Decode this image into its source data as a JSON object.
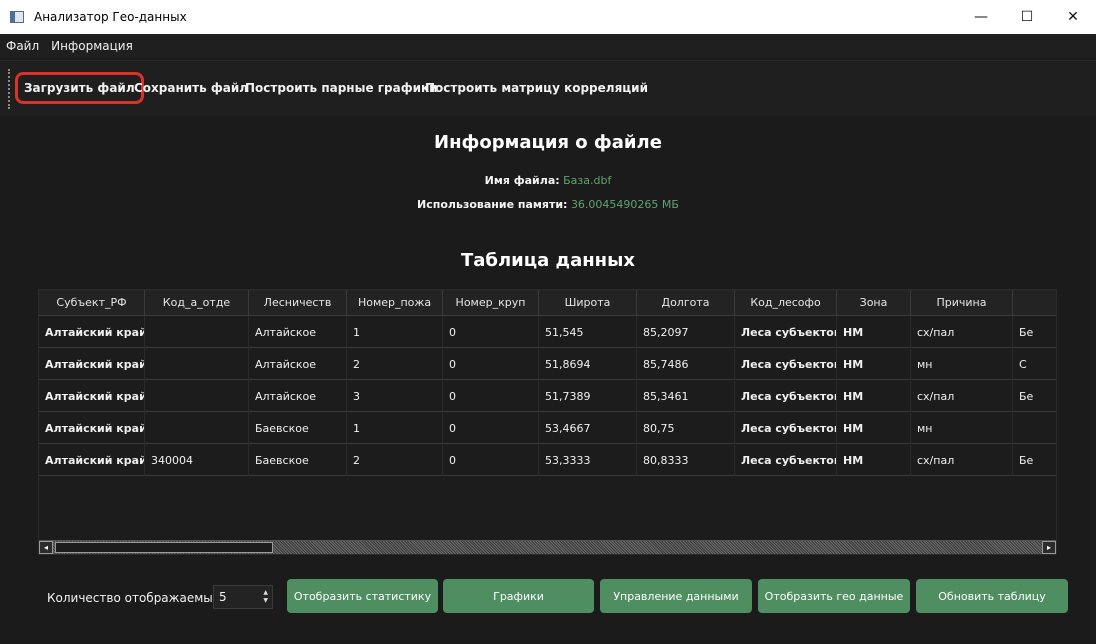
{
  "window": {
    "title": "Анализатор Гео-данных",
    "controls": {
      "minimize": "—",
      "maximize": "☐",
      "close": "✕"
    }
  },
  "menu": [
    "Файл",
    "Информация"
  ],
  "toolbar": {
    "load_file": "Загрузить файл",
    "save_file": "Сохранить файл",
    "pair_plots": "Построить парные графики",
    "corr_matrix": "Построить матрицу корреляций"
  },
  "file_info": {
    "heading": "Информация о файле",
    "name_label": "Имя файла:",
    "name_value": "База.dbf",
    "memory_label": "Использование памяти:",
    "memory_value": "36.0045490265 МБ"
  },
  "table": {
    "heading": "Таблица данных",
    "columns": [
      "Субъект_РФ",
      "Код_а_отде",
      "Лесничеств",
      "Номер_пожа",
      "Номер_круп",
      "Широта",
      "Долгота",
      "Код_лесофо",
      "Зона",
      "Причина",
      ""
    ],
    "rows": [
      [
        "Алтайский край",
        "",
        "Алтайское",
        "1",
        "0",
        "51,545",
        "85,2097",
        "Леса субъектов",
        "НМ",
        "сх/пал",
        "Бе"
      ],
      [
        "Алтайский край",
        "",
        "Алтайское",
        "2",
        "0",
        "51,8694",
        "85,7486",
        "Леса субъектов",
        "НМ",
        "мн",
        "С"
      ],
      [
        "Алтайский край",
        "",
        "Алтайское",
        "3",
        "0",
        "51,7389",
        "85,3461",
        "Леса субъектов",
        "НМ",
        "сх/пал",
        "Бе"
      ],
      [
        "Алтайский край",
        "",
        "Баевское",
        "1",
        "0",
        "53,4667",
        "80,75",
        "Леса субъектов",
        "НМ",
        "мн",
        ""
      ],
      [
        "Алтайский край",
        "340004",
        "Баевское",
        "2",
        "0",
        "53,3333",
        "80,8333",
        "Леса субъектов",
        "НМ",
        "сх/пал",
        "Бе"
      ]
    ],
    "scroll_left": "◂",
    "scroll_right": "▸"
  },
  "bottom": {
    "rows_label": "Количество отображаемых с",
    "rows_value": "5",
    "buttons": {
      "stats": "Отобразить статистику",
      "graphs": "Графики",
      "manage": "Управление данными",
      "geo": "Отобразить гео данные",
      "refresh": "Обновить таблицу"
    }
  },
  "colors": {
    "accent_green": "#4f8e60",
    "highlight_red": "#d8322a",
    "text_green": "#5fa36f"
  }
}
